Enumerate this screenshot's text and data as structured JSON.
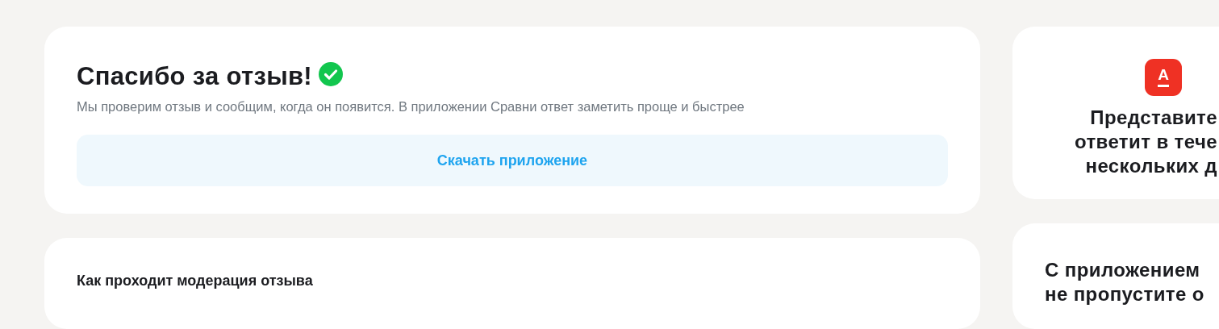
{
  "thanks_card": {
    "title": "Спасибо за отзыв!",
    "subtitle": "Мы проверим отзыв и сообщим, когда он появится. В приложении Сравни ответ заметить проще и быстрее",
    "download_button": "Скачать приложение"
  },
  "moderation_card": {
    "title": "Как проходит модерация отзыва"
  },
  "representative_card": {
    "logo_letter": "А",
    "lines": [
      "Представите",
      "ответит в тече",
      "нескольких д"
    ]
  },
  "app_card": {
    "lines": [
      "С приложением",
      "не пропустите о"
    ]
  }
}
